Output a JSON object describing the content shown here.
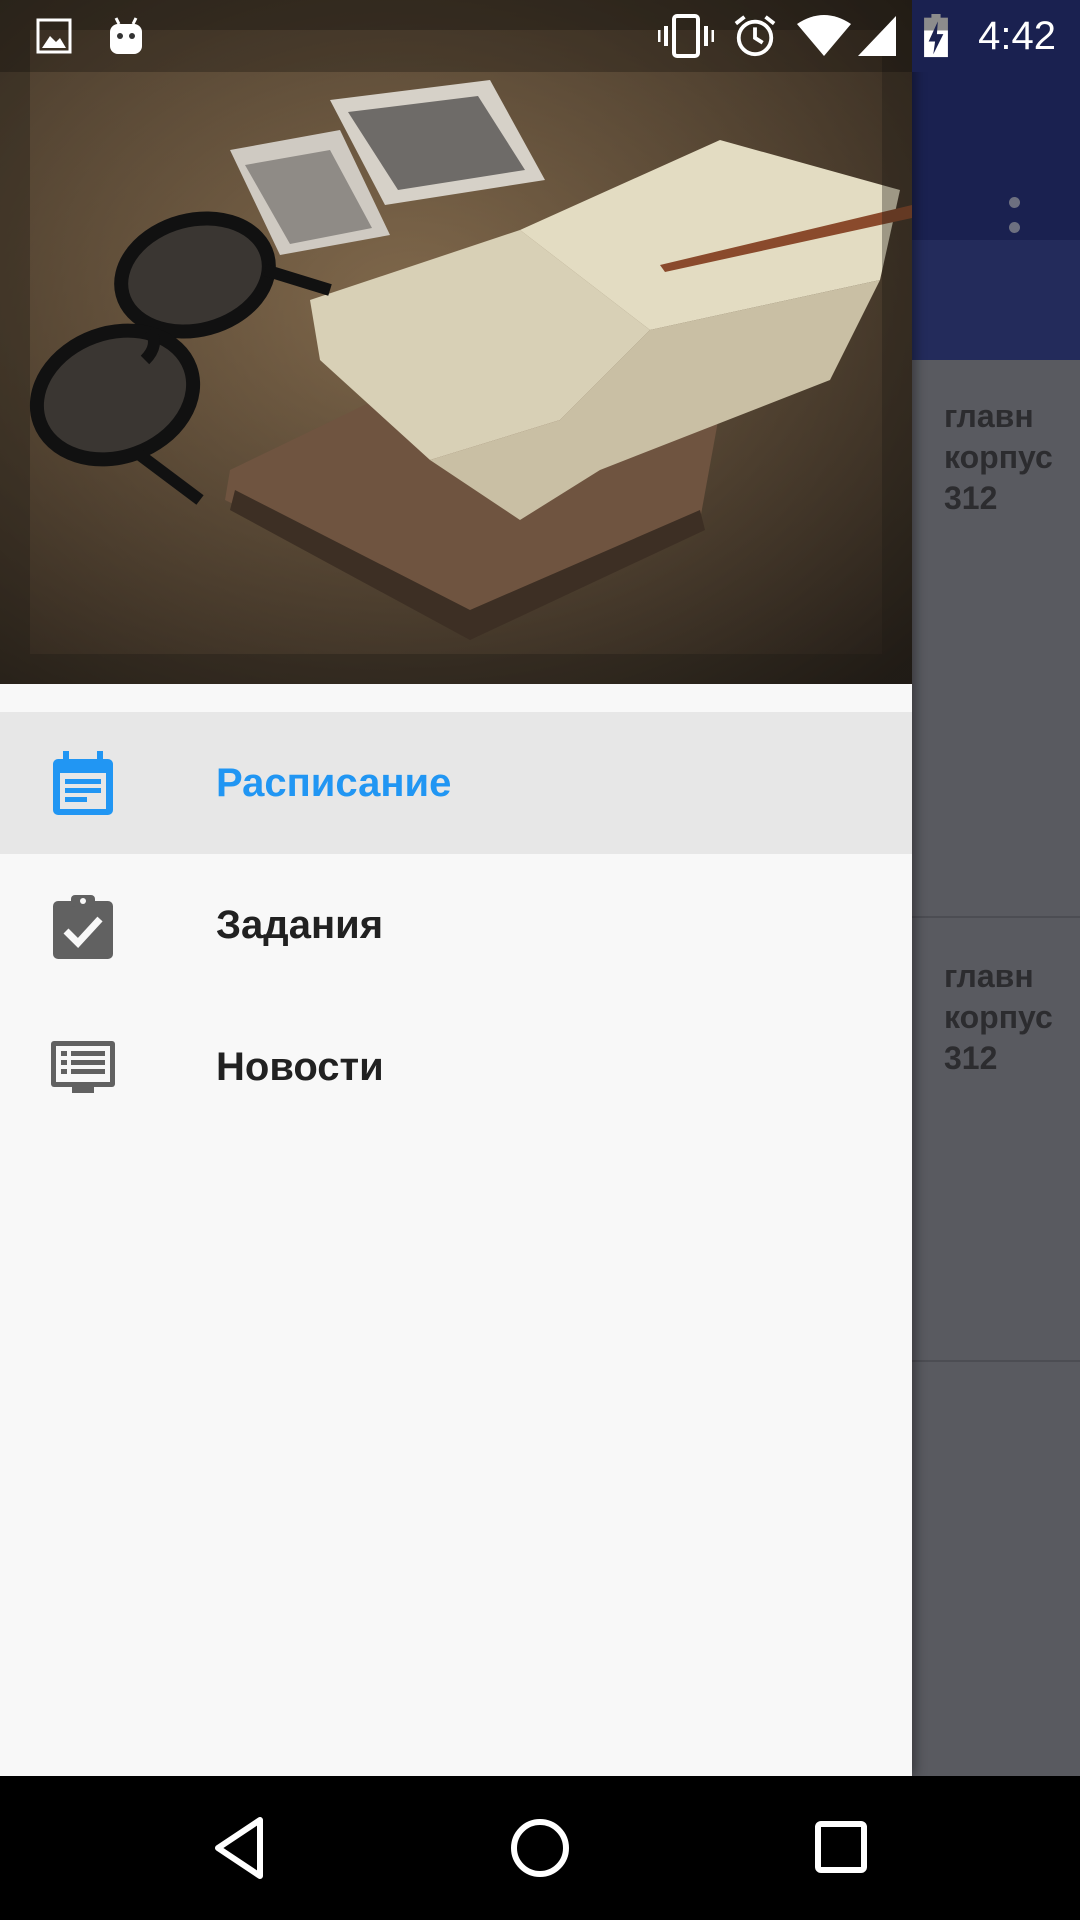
{
  "status_bar": {
    "time": "4:42",
    "icons": [
      "image-icon",
      "android-icon",
      "vibrate-icon",
      "alarm-icon",
      "wifi-icon",
      "signal-icon",
      "battery-charging-icon"
    ]
  },
  "app": {
    "toolbar": {
      "overflow_icon": "more-vert-icon",
      "color": "#1a2150"
    },
    "cards": [
      {
        "text": "главн\nкорпус\n312"
      },
      {
        "text": "главн\nкорпус\n312"
      }
    ]
  },
  "drawer": {
    "accent_color": "#2196f3",
    "items": [
      {
        "label": "Расписание",
        "icon": "calendar-icon",
        "active": true
      },
      {
        "label": "Задания",
        "icon": "assignment-check-icon",
        "active": false
      },
      {
        "label": "Новости",
        "icon": "news-icon",
        "active": false
      }
    ]
  },
  "nav_bar": {
    "buttons": [
      "back-icon",
      "home-icon",
      "recents-icon"
    ]
  }
}
